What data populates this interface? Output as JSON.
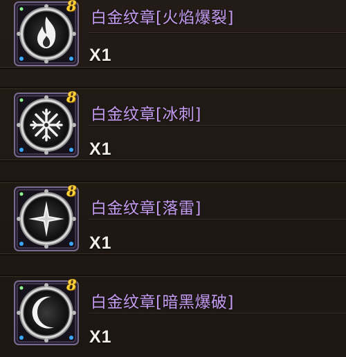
{
  "items": [
    {
      "name": "白金纹章[火焰爆裂]",
      "qty": "X1",
      "tier": "8",
      "icon": "flame-icon"
    },
    {
      "name": "白金纹章[冰刺]",
      "qty": "X1",
      "tier": "8",
      "icon": "snowflake-icon"
    },
    {
      "name": "白金纹章[落雷]",
      "qty": "X1",
      "tier": "8",
      "icon": "star-icon"
    },
    {
      "name": "白金纹章[暗黑爆破]",
      "qty": "X1",
      "tier": "8",
      "icon": "crescent-moon-icon"
    }
  ],
  "colors": {
    "name_text": "#c49cf2",
    "qty_text": "#f3efe9",
    "tier_badge": "#ffd23a",
    "background": "#1e1814"
  }
}
